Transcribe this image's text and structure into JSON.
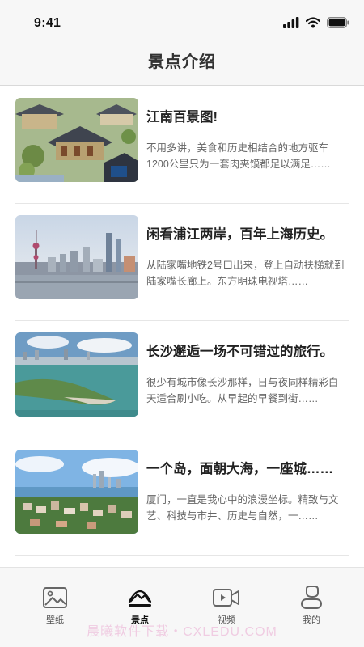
{
  "status_bar": {
    "time": "9:41"
  },
  "header": {
    "title": "景点介绍"
  },
  "articles": [
    {
      "title": "江南百景图!",
      "desc": "不用多讲，美食和历史相结合的地方驱车1200公里只为一套肉夹馍都足以满足……"
    },
    {
      "title": "闲看浦江两岸，百年上海历史。",
      "desc": "从陆家嘴地铁2号口出来，登上自动扶梯就到陆家嘴长廊上。东方明珠电视塔……"
    },
    {
      "title": "长沙邂逅一场不可错过的旅行。",
      "desc": "很少有城市像长沙那样，日与夜同样精彩白天适合刷小吃。从早起的早餐到街……"
    },
    {
      "title": "一个岛，面朝大海，一座城……",
      "desc": "厦门，一直是我心中的浪漫坐标。精致与文艺、科技与市井、历史与自然，一……"
    }
  ],
  "tab_bar": {
    "items": [
      {
        "label": "壁纸",
        "icon": "image-icon"
      },
      {
        "label": "景点",
        "icon": "landscape-icon"
      },
      {
        "label": "视频",
        "icon": "video-icon"
      },
      {
        "label": "我的",
        "icon": "user-icon"
      }
    ],
    "active_label": "景点"
  },
  "watermark": {
    "text": "晨曦软件下载・CXLEDU.COM"
  }
}
